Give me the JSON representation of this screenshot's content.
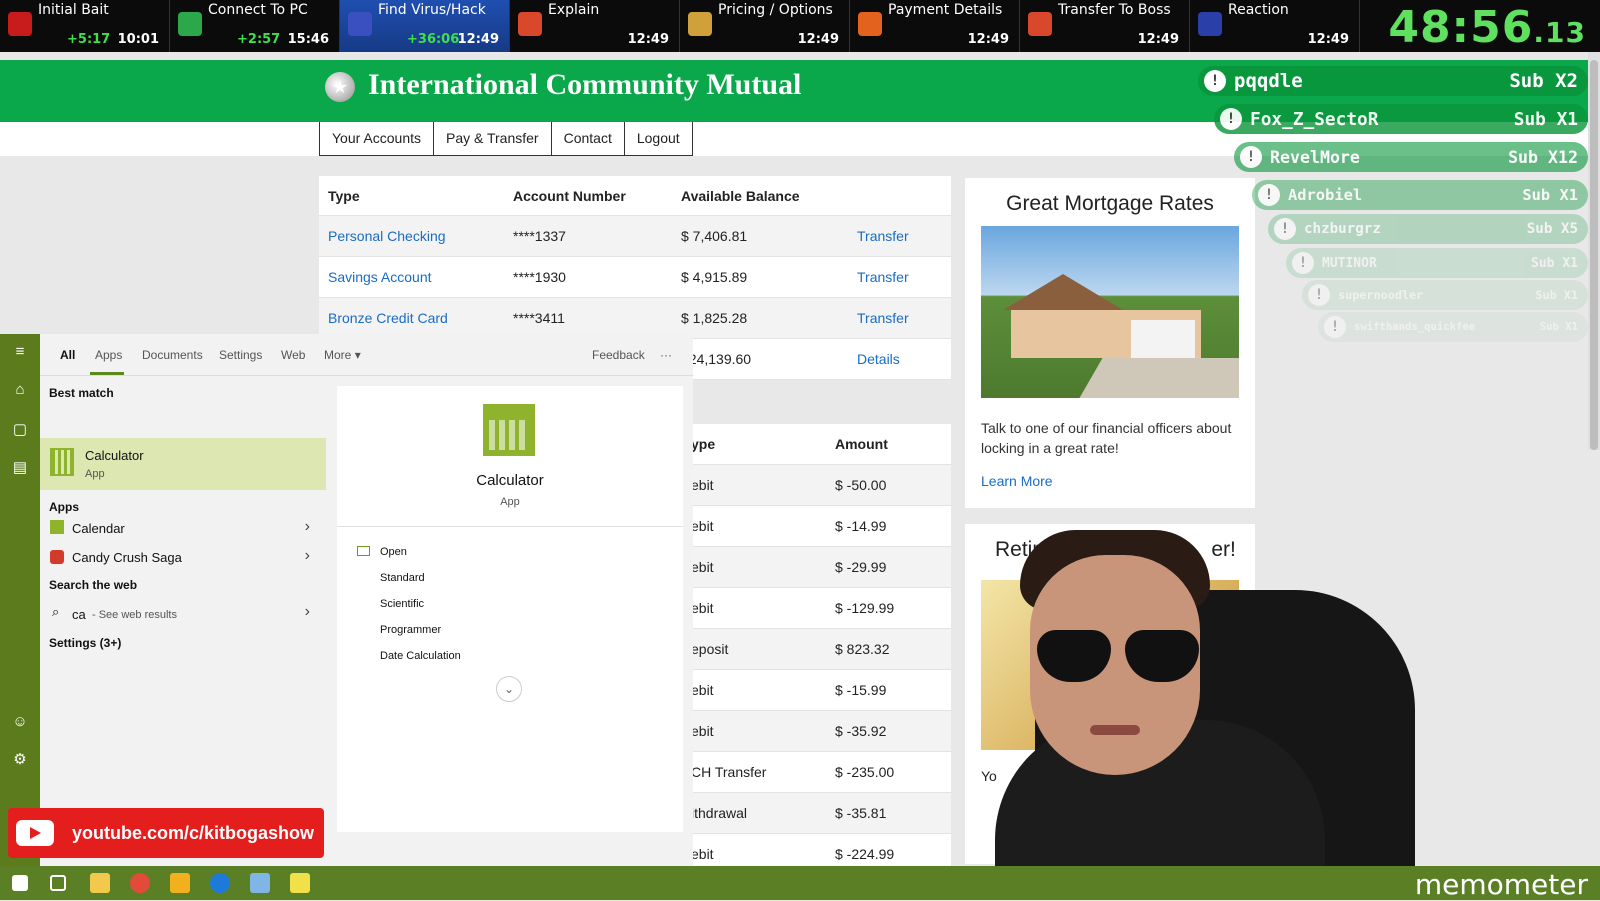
{
  "splits": [
    {
      "name": "Initial Bait",
      "delta": "+5:17",
      "time": "10:01",
      "icon_color": "#c81c1c"
    },
    {
      "name": "Connect To PC",
      "delta": "+2:57",
      "time": "15:46",
      "icon_color": "#2aa84a"
    },
    {
      "name": "Find Virus/Hack",
      "delta": "+36:06",
      "time": "12:49",
      "icon_color": "#3a4fc0"
    },
    {
      "name": "Explain",
      "delta": "",
      "time": "12:49",
      "icon_color": "#d9482a"
    },
    {
      "name": "Pricing / Options",
      "delta": "",
      "time": "12:49",
      "icon_color": "#d0a13a"
    },
    {
      "name": "Payment Details",
      "delta": "",
      "time": "12:49",
      "icon_color": "#e2621e"
    },
    {
      "name": "Transfer To Boss",
      "delta": "",
      "time": "12:49",
      "icon_color": "#d9482a"
    },
    {
      "name": "Reaction",
      "delta": "",
      "time": "12:49",
      "icon_color": "#2a3fa8"
    }
  ],
  "timer": {
    "main": "48:56",
    "fraction": ".13"
  },
  "bank": {
    "name": "International Community Mutual",
    "nav": [
      "Your Accounts",
      "Pay & Transfer",
      "Contact",
      "Logout"
    ],
    "accounts": {
      "headers": [
        "Type",
        "Account Number",
        "Available Balance",
        ""
      ],
      "rows": [
        {
          "type": "Personal Checking",
          "number": "****1337",
          "balance": "$ 7,406.81",
          "action": "Transfer"
        },
        {
          "type": "Savings Account",
          "number": "****1930",
          "balance": "$ 4,915.89",
          "action": "Transfer"
        },
        {
          "type": "Bronze Credit Card",
          "number": "****3411",
          "balance": "$ 1,825.28",
          "action": "Transfer"
        },
        {
          "type": "",
          "number": "",
          "balance": "$24,139.60",
          "action": "Details"
        }
      ]
    },
    "transactions": {
      "headers": [
        "ype",
        "Amount"
      ],
      "rows": [
        {
          "type": "ebit",
          "amount": "$ -50.00"
        },
        {
          "type": "ebit",
          "amount": "$ -14.99"
        },
        {
          "type": "ebit",
          "amount": "$ -29.99"
        },
        {
          "type": "ebit",
          "amount": "$ -129.99"
        },
        {
          "type": "eposit",
          "amount": "$ 823.32"
        },
        {
          "type": "ebit",
          "amount": "$ -15.99"
        },
        {
          "type": "ebit",
          "amount": "$ -35.92"
        },
        {
          "type": "CH Transfer",
          "amount": "$ -235.00"
        },
        {
          "type": "ithdrawal",
          "amount": "$ -35.81"
        },
        {
          "type": "ebit",
          "amount": "$ -224.99"
        }
      ]
    },
    "mortgage_card": {
      "title": "Great Mortgage Rates",
      "text": "Talk to one of our financial officers about locking in a great rate!",
      "link": "Learn More"
    },
    "retire_card": {
      "title": "Retire Fo",
      "title_end": "er!",
      "text": "Yo"
    }
  },
  "subs": [
    {
      "name": "pqqdle",
      "count": "Sub X2"
    },
    {
      "name": "Fox_Z_SectoR",
      "count": "Sub X1"
    },
    {
      "name": "RevelMore",
      "count": "Sub X12"
    },
    {
      "name": "Adrobiel",
      "count": "Sub X1"
    },
    {
      "name": "chzburgrz",
      "count": "Sub X5"
    },
    {
      "name": "MUTINOR",
      "count": "Sub X1"
    },
    {
      "name": "supernoodler",
      "count": "Sub X1"
    },
    {
      "name": "swifthands_quickfee",
      "count": "Sub X1"
    }
  ],
  "start_menu": {
    "tabs": [
      "All",
      "Apps",
      "Documents",
      "Settings",
      "Web",
      "More"
    ],
    "feedback": "Feedback",
    "more_dots": "···",
    "best_match_label": "Best match",
    "best_match": {
      "name": "Calculator",
      "kind": "App"
    },
    "apps_label": "Apps",
    "apps": [
      "Calendar",
      "Candy Crush Saga"
    ],
    "web_label": "Search the web",
    "web_query": "ca",
    "web_suffix": "- See web results",
    "settings_label": "Settings (3+)",
    "preview": {
      "title": "Calculator",
      "kind": "App",
      "actions": [
        "Open",
        "Standard",
        "Scientific",
        "Programmer",
        "Date Calculation"
      ]
    }
  },
  "youtube_banner": "youtube.com/c/kitbogashow",
  "watermark": "memometer"
}
